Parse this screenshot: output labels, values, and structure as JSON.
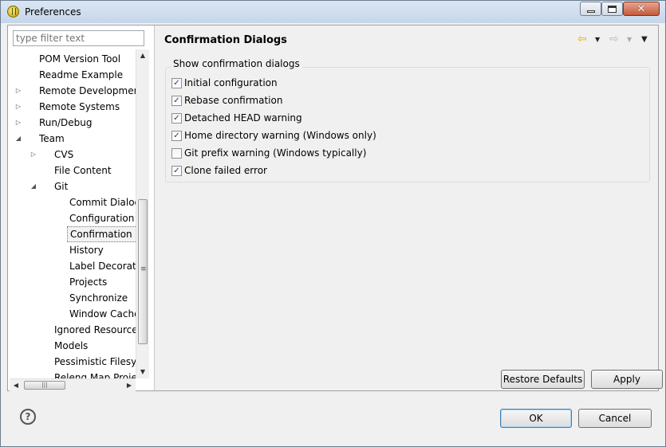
{
  "window": {
    "title": "Preferences"
  },
  "filter": {
    "placeholder": "type filter text"
  },
  "tree": {
    "items": [
      {
        "label": "POM Version Tool",
        "indent": 0,
        "expander": ""
      },
      {
        "label": "Readme Example",
        "indent": 0,
        "expander": ""
      },
      {
        "label": "Remote Development",
        "indent": 0,
        "expander": "collapsed"
      },
      {
        "label": "Remote Systems",
        "indent": 0,
        "expander": "collapsed"
      },
      {
        "label": "Run/Debug",
        "indent": 0,
        "expander": "collapsed"
      },
      {
        "label": "Team",
        "indent": 0,
        "expander": "expanded"
      },
      {
        "label": "CVS",
        "indent": 1,
        "expander": "collapsed"
      },
      {
        "label": "File Content",
        "indent": 1,
        "expander": ""
      },
      {
        "label": "Git",
        "indent": 1,
        "expander": "expanded"
      },
      {
        "label": "Commit Dialog",
        "indent": 2,
        "expander": ""
      },
      {
        "label": "Configuration",
        "indent": 2,
        "expander": ""
      },
      {
        "label": "Confirmation Dialogs",
        "indent": 2,
        "expander": "",
        "selected": true
      },
      {
        "label": "History",
        "indent": 2,
        "expander": ""
      },
      {
        "label": "Label Decorations",
        "indent": 2,
        "expander": ""
      },
      {
        "label": "Projects",
        "indent": 2,
        "expander": ""
      },
      {
        "label": "Synchronize",
        "indent": 2,
        "expander": ""
      },
      {
        "label": "Window Cache",
        "indent": 2,
        "expander": ""
      },
      {
        "label": "Ignored Resources",
        "indent": 1,
        "expander": ""
      },
      {
        "label": "Models",
        "indent": 1,
        "expander": ""
      },
      {
        "label": "Pessimistic Filesystem",
        "indent": 1,
        "expander": ""
      },
      {
        "label": "Releng Map Projects",
        "indent": 1,
        "expander": ""
      }
    ]
  },
  "page": {
    "title": "Confirmation Dialogs",
    "group_label": "Show confirmation dialogs",
    "options": [
      {
        "label": "Initial configuration",
        "checked": true
      },
      {
        "label": "Rebase confirmation",
        "checked": true
      },
      {
        "label": "Detached HEAD warning",
        "checked": true
      },
      {
        "label": "Home directory warning (Windows only)",
        "checked": true
      },
      {
        "label": "Git prefix warning (Windows typically)",
        "checked": false
      },
      {
        "label": "Clone failed error",
        "checked": true
      }
    ],
    "restore_defaults": "Restore Defaults",
    "apply": "Apply"
  },
  "footer": {
    "ok": "OK",
    "cancel": "Cancel"
  },
  "icons": {
    "back": "back-arrow-icon",
    "forward": "forward-arrow-icon",
    "menu": "view-menu-icon",
    "help": "help-icon"
  },
  "colors": {
    "nav_back_arrow": "#e2b000",
    "nav_forward_arrow": "#b8b8b8",
    "checkmark": "#21407a"
  }
}
